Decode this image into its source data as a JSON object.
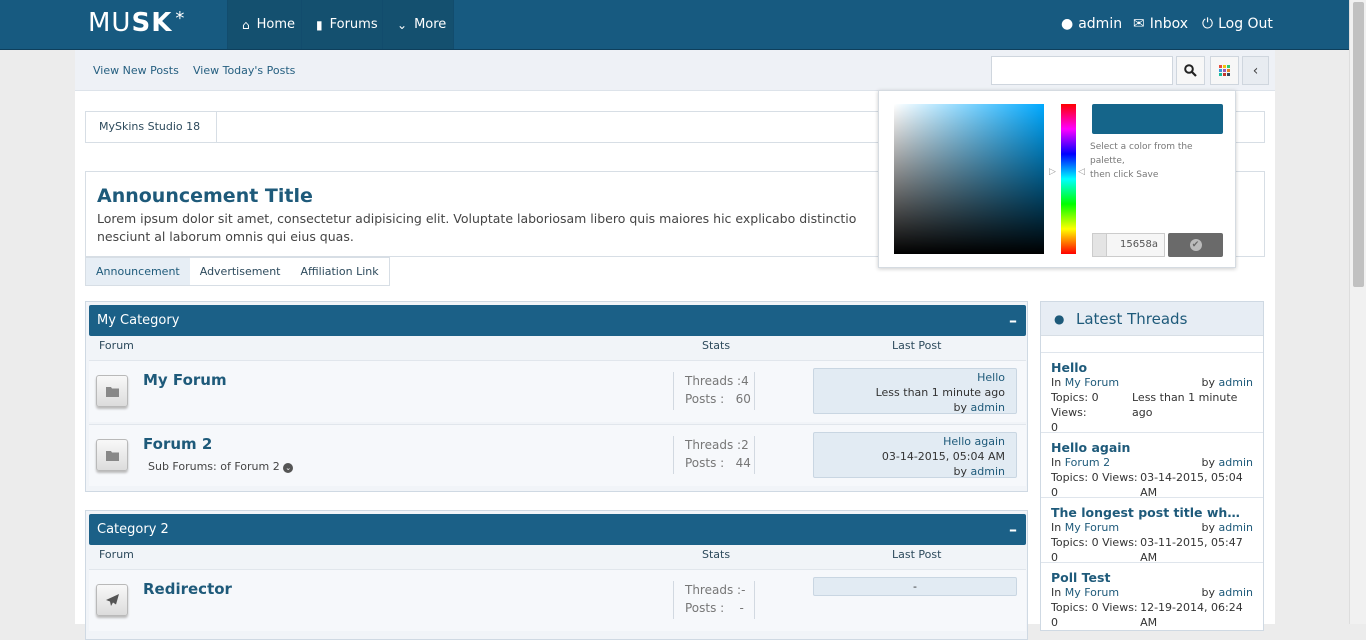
{
  "header": {
    "logo_light": "MU",
    "logo_bold": "SK",
    "logo_star": "*",
    "nav": {
      "home": "Home",
      "forums": "Forums",
      "more": "More"
    },
    "user": {
      "name": "admin",
      "inbox": "Inbox",
      "logout": "Log Out"
    }
  },
  "subnav": {
    "new_posts": "View New Posts",
    "todays_posts": "View Today's Posts",
    "search_placeholder": ""
  },
  "breadcrumb": {
    "item": "MySkins Studio 18"
  },
  "announcement": {
    "title": "Announcement Title",
    "body": "Lorem ipsum dolor sit amet, consectetur adipisicing elit. Voluptate laboriosam libero quis maiores hic explicabo distinctio nesciunt al laborum omnis qui eius quas.",
    "tabs": [
      "Announcement",
      "Advertisement",
      "Affiliation Link"
    ]
  },
  "columns": {
    "forum": "Forum",
    "stats": "Stats",
    "last_post": "Last Post"
  },
  "categories": [
    {
      "name": "My Category",
      "minimize": "–",
      "forums": [
        {
          "name": "My Forum",
          "threads_label": "Threads :",
          "threads": "4",
          "posts_label": "Posts :",
          "posts": "60",
          "last_title": "Hello",
          "last_time": "Less than 1 minute ago",
          "last_by": "by",
          "last_user": "admin"
        },
        {
          "name": "Forum 2",
          "subforums": "Sub Forums: of Forum 2",
          "threads_label": "Threads :",
          "threads": "2",
          "posts_label": "Posts :",
          "posts": "44",
          "last_title": "Hello again",
          "last_time": "03-14-2015, 05:04 AM",
          "last_by": "by",
          "last_user": "admin"
        }
      ]
    },
    {
      "name": "Category 2",
      "minimize": "–",
      "forums": [
        {
          "name": "Redirector",
          "threads_label": "Threads :",
          "threads": "-",
          "posts_label": "Posts :",
          "posts": "-",
          "last_title": "-"
        }
      ]
    }
  ],
  "latest_threads": {
    "title": "Latest Threads",
    "items": [
      {
        "title": "Hello",
        "in": "In",
        "forum": "My Forum",
        "by": "by",
        "user": "admin",
        "meta": "Topics: 0 Views:",
        "time": "Less than 1 minute ago",
        "extra": "0"
      },
      {
        "title": "Hello again",
        "in": "In",
        "forum": "Forum 2",
        "by": "by",
        "user": "admin",
        "meta": "Topics: 0 Views: 0",
        "time": "03-14-2015, 05:04 AM"
      },
      {
        "title": "The longest post title wh…",
        "in": "In",
        "forum": "My Forum",
        "by": "by",
        "user": "admin",
        "meta": "Topics: 0 Views: 0",
        "time": "03-11-2015, 05:47 AM"
      },
      {
        "title": "Poll Test",
        "in": "In",
        "forum": "My Forum",
        "by": "by",
        "user": "admin",
        "meta": "Topics: 0 Views: 0",
        "time": "12-19-2014, 06:24 AM"
      }
    ]
  },
  "color_picker": {
    "message_line1": "Select a color from the palette,",
    "message_line2": "then click Save",
    "hex": "15658a",
    "selected_color": "#15658a"
  },
  "colors": {
    "header_bg": "#175a80",
    "category_bg": "#1b6087",
    "link": "#1e5a7a"
  }
}
